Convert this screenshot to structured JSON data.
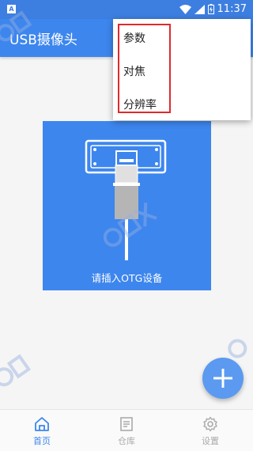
{
  "status_bar": {
    "notification_icon": "A",
    "battery_icon": "battery-charging-icon",
    "time": "11:37"
  },
  "app_bar": {
    "title": "USB摄像头"
  },
  "menu": {
    "items": [
      {
        "label": "参数"
      },
      {
        "label": "对焦"
      },
      {
        "label": "分辨率"
      }
    ]
  },
  "hero": {
    "caption": "请插入OTG设备",
    "icon": "usb-plug-icon"
  },
  "fab": {
    "icon": "plus-icon"
  },
  "bottom_nav": {
    "items": [
      {
        "label": "首页",
        "icon": "home-icon"
      },
      {
        "label": "仓库",
        "icon": "file-list-icon"
      },
      {
        "label": "设置",
        "icon": "gear-icon"
      }
    ]
  },
  "colors": {
    "primary": "#3d86ee",
    "menu_highlight": "#e02a2a",
    "nav_active": "#3d86ee",
    "nav_inactive": "#aaaaaa"
  }
}
